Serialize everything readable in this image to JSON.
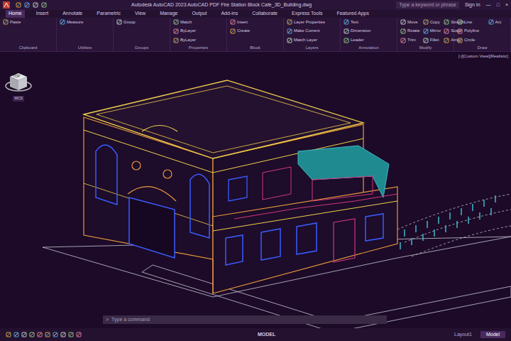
{
  "title_bar": {
    "title": "Autodesk AutoCAD 2023  AutoCAD PDF Fire Station Block Cafe_3D_Building.dwg",
    "search_placeholder": "Type a keyword or phrase",
    "user": "Sign In",
    "controls": [
      "—",
      "□",
      "×"
    ]
  },
  "ribbon_tabs": [
    {
      "label": "Home",
      "selected": true
    },
    {
      "label": "Insert",
      "selected": false
    },
    {
      "label": "Annotate",
      "selected": false
    },
    {
      "label": "Parametric",
      "selected": false
    },
    {
      "label": "View",
      "selected": false
    },
    {
      "label": "Manage",
      "selected": false
    },
    {
      "label": "Output",
      "selected": false
    },
    {
      "label": "Add-ins",
      "selected": false
    },
    {
      "label": "Collaborate",
      "selected": false
    },
    {
      "label": "Express Tools",
      "selected": false
    },
    {
      "label": "Featured Apps",
      "selected": false
    }
  ],
  "ribbon_panels": [
    {
      "label": "Clipboard",
      "tools": [
        "Paste"
      ]
    },
    {
      "label": "Utilities",
      "tools": [
        "Measure"
      ]
    },
    {
      "label": "Groups",
      "tools": [
        "Group"
      ]
    },
    {
      "label": "Properties",
      "tools": [
        "Match",
        "ByLayer",
        "ByLayer"
      ]
    },
    {
      "label": "Block",
      "tools": [
        "Insert",
        "Create"
      ]
    },
    {
      "label": "Layers",
      "tools": [
        "Layer Properties",
        "Make Current",
        "Match Layer"
      ]
    },
    {
      "label": "Annotation",
      "tools": [
        "Text",
        "Dimension",
        "Leader"
      ]
    },
    {
      "label": "Modify",
      "tools": [
        "Move",
        "Rotate",
        "Trim",
        "Copy",
        "Mirror",
        "Fillet",
        "Stretch",
        "Scale",
        "Array"
      ]
    },
    {
      "label": "Draw",
      "tools": [
        "Line",
        "Polyline",
        "Circle",
        "Arc"
      ]
    }
  ],
  "viewport": {
    "label": "[-][Custom View][Realistic]",
    "viewcube": {
      "face": "TOP",
      "wcs": "WCS"
    }
  },
  "command_line": {
    "placeholder": "Type a command"
  },
  "status_bar": {
    "mode": "MODEL",
    "layout_tabs": [
      {
        "label": "Layout1",
        "selected": false
      },
      {
        "label": "Model",
        "selected": true
      }
    ]
  }
}
